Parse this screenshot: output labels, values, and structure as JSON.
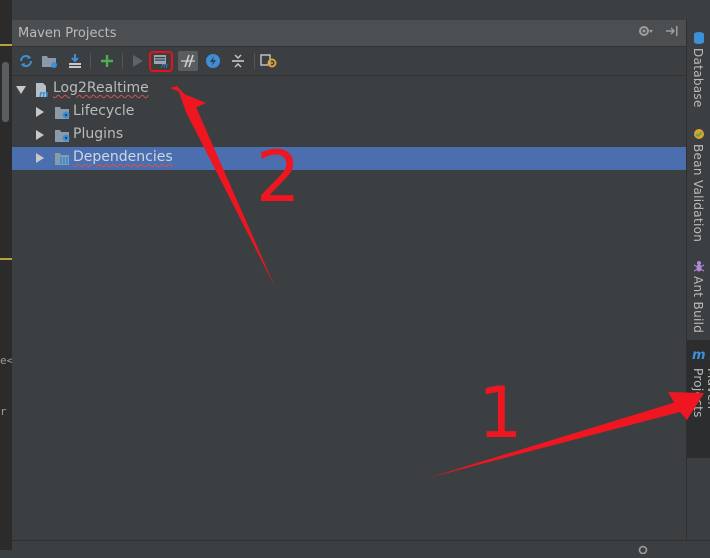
{
  "panel": {
    "title": "Maven Projects"
  },
  "toolbar": {
    "buttons": [
      {
        "icon": "reimport-all-icon"
      },
      {
        "icon": "generate-sources-icon"
      },
      {
        "icon": "download-sources-icon"
      },
      {
        "icon": "add-maven-project-icon"
      },
      {
        "icon": "run-maven-build-icon"
      },
      {
        "icon": "execute-maven-goal-icon"
      },
      {
        "icon": "toggle-offline-mode-icon"
      },
      {
        "icon": "toggle-skip-tests-icon"
      },
      {
        "icon": "collapse-all-icon"
      },
      {
        "icon": "maven-settings-icon"
      }
    ],
    "highlighted": "execute-maven-goal-icon"
  },
  "tree": {
    "root": {
      "label": "Log2Realtime",
      "expanded": true
    },
    "children": [
      {
        "label": "Lifecycle",
        "expanded": false,
        "selected": false
      },
      {
        "label": "Plugins",
        "expanded": false,
        "selected": false
      },
      {
        "label": "Dependencies",
        "expanded": false,
        "selected": true
      }
    ]
  },
  "right_tabs": [
    {
      "label": "Database",
      "icon": "database-icon",
      "active": false
    },
    {
      "label": "Bean Validation",
      "icon": "bean-validation-icon",
      "active": false
    },
    {
      "label": "Ant Build",
      "icon": "ant-icon",
      "active": false
    },
    {
      "label": "Maven Projects",
      "icon": "maven-icon",
      "active": true
    }
  ],
  "editor_fragments": {
    "a": "e<",
    "b": "r"
  },
  "annotations": {
    "label_one": "1",
    "label_two": "2",
    "color": "#ee1620"
  },
  "colors": {
    "selection": "#4b6eaf",
    "panel_bg": "#3c3f41",
    "header_bg": "#4b4f52",
    "highlight_border": "#e8101a"
  }
}
